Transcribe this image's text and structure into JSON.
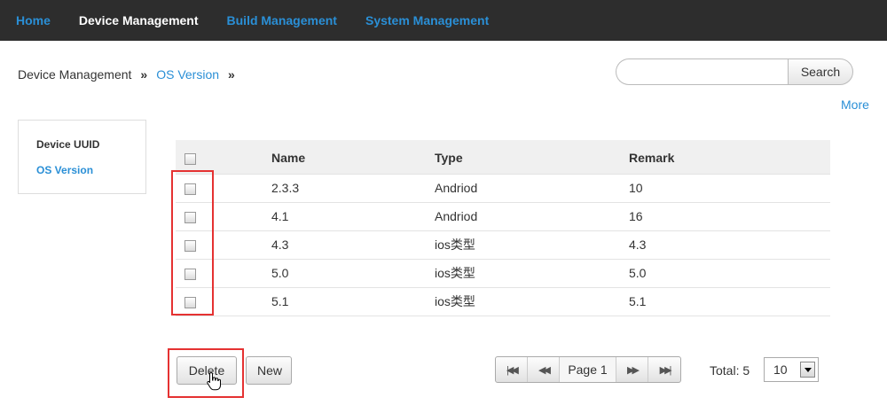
{
  "nav": {
    "items": [
      {
        "label": "Home"
      },
      {
        "label": "Device Management"
      },
      {
        "label": "Build Management"
      },
      {
        "label": "System Management"
      }
    ]
  },
  "breadcrumb": {
    "items": [
      "Device Management",
      "OS Version"
    ],
    "separator": "»"
  },
  "search": {
    "placeholder": "",
    "value": "",
    "button_label": "Search"
  },
  "more_label": "More",
  "sidebar": {
    "items": [
      {
        "label": "Device UUID"
      },
      {
        "label": "OS Version"
      }
    ]
  },
  "table": {
    "columns": [
      "Name",
      "Type",
      "Remark"
    ],
    "rows": [
      {
        "name": "2.3.3",
        "type": "Andriod",
        "remark": "10"
      },
      {
        "name": "4.1",
        "type": "Andriod",
        "remark": "16"
      },
      {
        "name": "4.3",
        "type": "ios类型",
        "remark": "4.3"
      },
      {
        "name": "5.0",
        "type": "ios类型",
        "remark": "5.0"
      },
      {
        "name": "5.1",
        "type": "ios类型",
        "remark": "5.1"
      }
    ]
  },
  "actions": {
    "delete_label": "Delete",
    "new_label": "New"
  },
  "pager": {
    "page_label": "Page 1",
    "total_label": "Total: 5",
    "page_size": "10"
  },
  "colors": {
    "nav_bg": "#2d2d2d",
    "link": "#2a8fd6",
    "highlight": "#e53232"
  },
  "icons": {
    "first_page": "first-page-icon",
    "prev_page": "prev-page-icon",
    "next_page": "next-page-icon",
    "last_page": "last-page-icon",
    "dropdown": "chevron-down-icon",
    "cursor": "hand-pointer-icon"
  }
}
